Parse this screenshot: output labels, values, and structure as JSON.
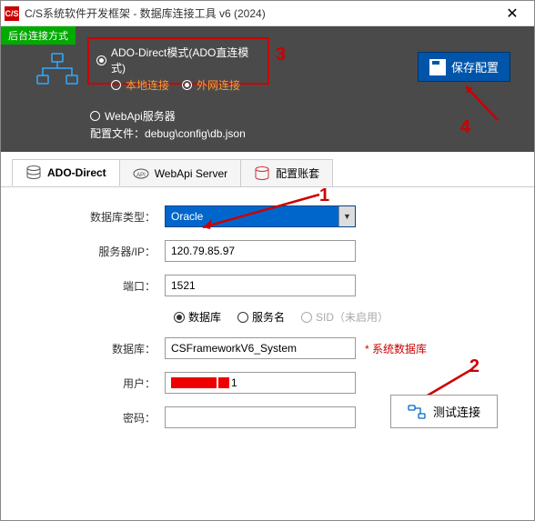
{
  "window": {
    "title": "C/S系统软件开发框架 - 数据库连接工具 v6 (2024)",
    "app_icon_text": "C/S"
  },
  "header": {
    "tag": "后台连接方式",
    "ado_mode": "ADO-Direct模式(ADO直连模式)",
    "local_conn": "本地连接",
    "external_conn": "外网连接",
    "webapi": "WebApi服务器",
    "config_label": "配置文件：",
    "config_path": "debug\\config\\db.json",
    "save_btn": "保存配置"
  },
  "tabs": [
    {
      "label": "ADO-Direct"
    },
    {
      "label": "WebApi Server"
    },
    {
      "label": "配置账套"
    }
  ],
  "form": {
    "db_type_label": "数据库类型：",
    "db_type_value": "Oracle",
    "server_label": "服务器/IP：",
    "server_value": "120.79.85.97",
    "port_label": "端口：",
    "port_value": "1521",
    "radio_db": "数据库",
    "radio_svc": "服务名",
    "radio_sid": "SID（未启用）",
    "db_label": "数据库：",
    "db_value": "CSFrameworkV6_System",
    "db_hint": "* 系统数据库",
    "user_label": "用户：",
    "user_suffix": "1",
    "pwd_label": "密码：",
    "pwd_value": "",
    "test_btn": "测试连接"
  },
  "annotations": {
    "n1": "1",
    "n2": "2",
    "n3": "3",
    "n4": "4"
  }
}
